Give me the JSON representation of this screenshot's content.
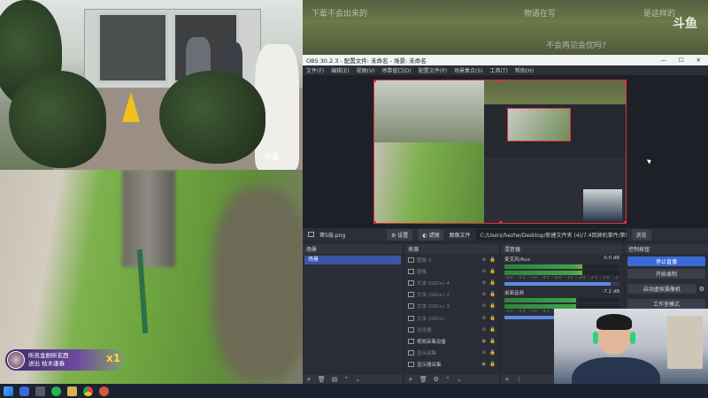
{
  "watermark": {
    "brand": "斗鱼"
  },
  "stream_captions": {
    "line1": "下辈不会出来的",
    "line2": "物语在写",
    "line3": "是这样的",
    "line4": "不会再见会优吗?"
  },
  "donor": {
    "name": "昕凯金剧昕玄西",
    "action": "送出 枯木逢春",
    "multiplier": "x1"
  },
  "obs": {
    "title": "OBS 30.2.3 - 配置文件: 未命名 - 场景: 未命名",
    "window_controls": [
      "—",
      "☐",
      "✕"
    ],
    "menu": [
      "文件(F)",
      "编辑(E)",
      "视图(V)",
      "停靠窗口(D)",
      "配置文件(P)",
      "场景集合(S)",
      "工具(T)",
      "帮助(H)"
    ],
    "toolbar": {
      "source_name": "第5局.png",
      "settings_label": "设置",
      "filters_label": "滤镜",
      "image_file_label": "图像文件",
      "path_value": "C:/Users/hezhe/Desktop/新建文件夹 (4)/7.4回顾机事件/第5局.png",
      "browse_label": "浏览"
    },
    "scenes": {
      "header": "场景",
      "items": [
        "场景"
      ]
    },
    "sources": {
      "header": "来源",
      "items": [
        {
          "label": "图像 2",
          "active": false
        },
        {
          "label": "图像",
          "active": false
        },
        {
          "label": "文本 (GDI+) 4",
          "active": false
        },
        {
          "label": "文本 (GDI+) 2",
          "active": false
        },
        {
          "label": "文本 (GDI+) 3",
          "active": false
        },
        {
          "label": "文本 (GDI+)",
          "active": false
        },
        {
          "label": "浏览器",
          "active": false
        },
        {
          "label": "视频采集设备",
          "active": true
        },
        {
          "label": "显示采集",
          "active": false
        },
        {
          "label": "显示器采集",
          "active": true
        }
      ]
    },
    "mixer": {
      "header": "混音器",
      "tracks": [
        {
          "name": "麦克风/Aux",
          "db": "0.0 dB",
          "level": 0.68,
          "volume": 0.92
        },
        {
          "name": "桌面音频",
          "db": "-7.2 dB",
          "level": 0.62,
          "volume": 0.8
        }
      ],
      "scale": "-60 -55 -50 -45 -40 -35 -30 -25 -20 -15 -10 -5 0"
    },
    "controls": {
      "header": "控制按钮",
      "stop_stream": "停止直播",
      "start_record": "开始录制",
      "virtual_cam": "启动虚拟摄像机",
      "studio_mode": "工作室模式"
    }
  },
  "colors": {
    "accent": "#3a6ad6",
    "selection_border": "#e0303a",
    "obs_bg": "#272a33"
  },
  "taskbar": {
    "icons": [
      "windows-start",
      "search",
      "task-view",
      "wechat",
      "file-explorer",
      "chrome",
      "obs"
    ]
  }
}
